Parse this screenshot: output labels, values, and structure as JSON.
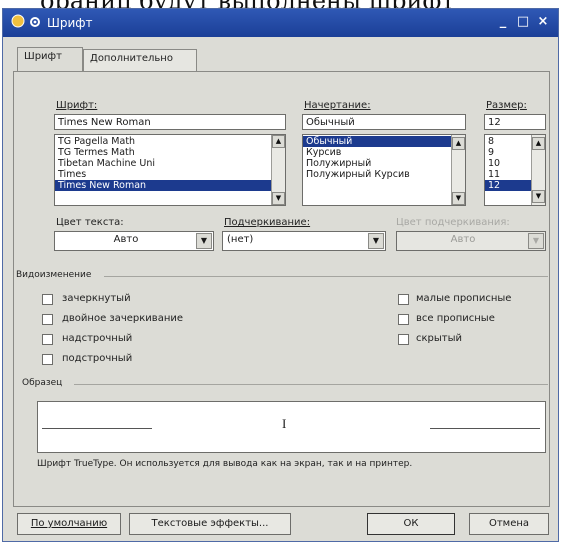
{
  "background_text": "ораниц будут выполнены шрифт",
  "window": {
    "title": "Шрифт",
    "minimize": "_",
    "maximize": "□",
    "close": "×"
  },
  "tabs": [
    {
      "label": "Шрифт",
      "active": true
    },
    {
      "label": "Дополнительно",
      "active": false
    }
  ],
  "font": {
    "label": "Шрифт:",
    "value": "Times New Roman",
    "list": [
      "TG Pagella Math",
      "TG Termes Math",
      "Tibetan Machine Uni",
      "Times",
      "Times New Roman"
    ],
    "selected_index": 4
  },
  "style": {
    "label": "Начертание:",
    "value": "Обычный",
    "list": [
      "Обычный",
      "Курсив",
      "Полужирный",
      "Полужирный Курсив"
    ],
    "selected_index": 0
  },
  "size": {
    "label": "Размер:",
    "value": "12",
    "list": [
      "8",
      "9",
      "10",
      "11",
      "12"
    ],
    "selected_index": 4
  },
  "font_color": {
    "label": "Цвет текста:",
    "value": "Авто"
  },
  "underline": {
    "label": "Подчеркивание:",
    "value": "(нет)"
  },
  "underline_color": {
    "label": "Цвет подчеркивания:",
    "value": "Авто",
    "disabled": true
  },
  "effects": {
    "group_label": "Видоизменение",
    "left": [
      "зачеркнутый",
      "двойное зачеркивание",
      "надстрочный",
      "подстрочный"
    ],
    "right": [
      "малые прописные",
      "все прописные",
      "скрытый"
    ]
  },
  "sample": {
    "group_label": "Образец",
    "caret": "I",
    "note": "Шрифт TrueType. Он используется для вывода как на экран, так и на принтер."
  },
  "buttons": {
    "default": "По умолчанию",
    "text_effects": "Текстовые эффекты...",
    "ok": "ОК",
    "cancel": "Отмена"
  },
  "colors": {
    "titlebar": "#1b3f97",
    "selection": "#1c3a8e",
    "dialog_bg": "#dcdcd6"
  }
}
